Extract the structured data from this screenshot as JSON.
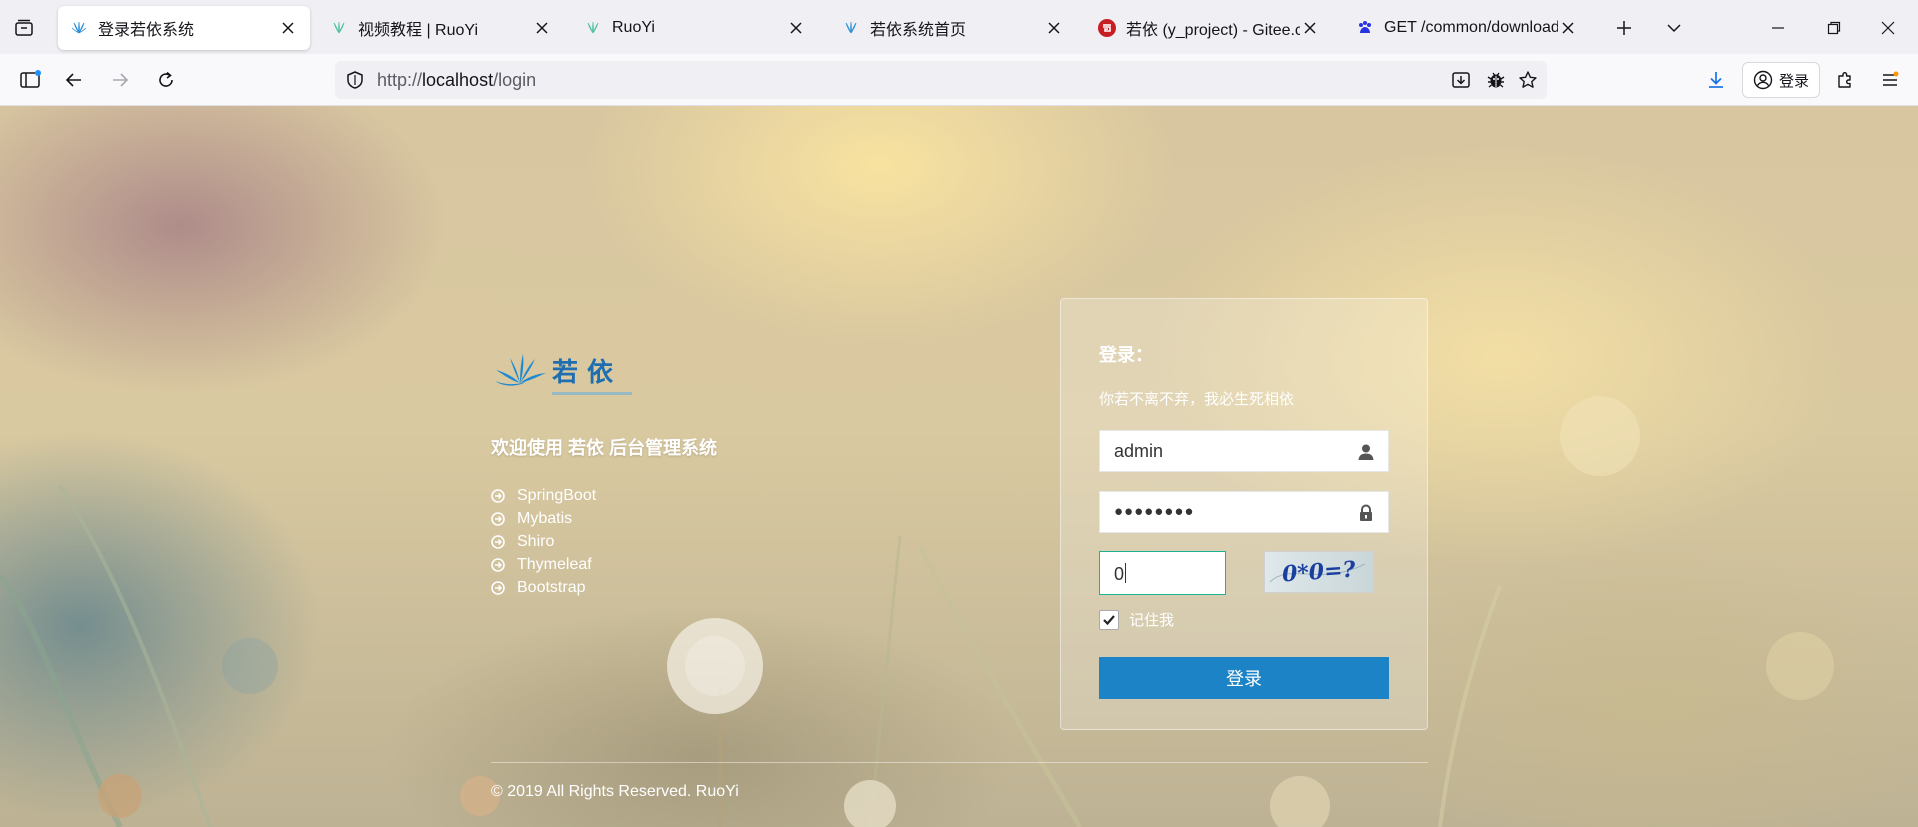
{
  "browser": {
    "tabs": [
      {
        "title": "登录若依系统",
        "active": true
      },
      {
        "title": "视频教程 | RuoYi",
        "active": false
      },
      {
        "title": "RuoYi",
        "active": false
      },
      {
        "title": "若依系统首页",
        "active": false
      },
      {
        "title": "若依 (y_project) - Gitee.com",
        "active": false
      },
      {
        "title": "GET /common/download?",
        "active": false
      }
    ],
    "url_scheme": "http://",
    "url_host": "localhost",
    "url_path": "/login",
    "signin_label": "登录"
  },
  "page": {
    "welcome": "欢迎使用 若依 后台管理系统",
    "features": [
      "SpringBoot",
      "Mybatis",
      "Shiro",
      "Thymeleaf",
      "Bootstrap"
    ],
    "login": {
      "title": "登录：",
      "subtitle": "你若不离不弃，我必生死相依",
      "username_value": "admin",
      "password_mask": "●●●●●●●●",
      "captcha_value": "0",
      "captcha_text": "0*0=?",
      "remember_label": "记住我",
      "remember_checked": true,
      "submit_label": "登录"
    },
    "footer": "© 2019 All Rights Reserved. RuoYi"
  },
  "colors": {
    "primary_button": "#1c84c6",
    "captcha_focus_border": "#1ab394"
  }
}
